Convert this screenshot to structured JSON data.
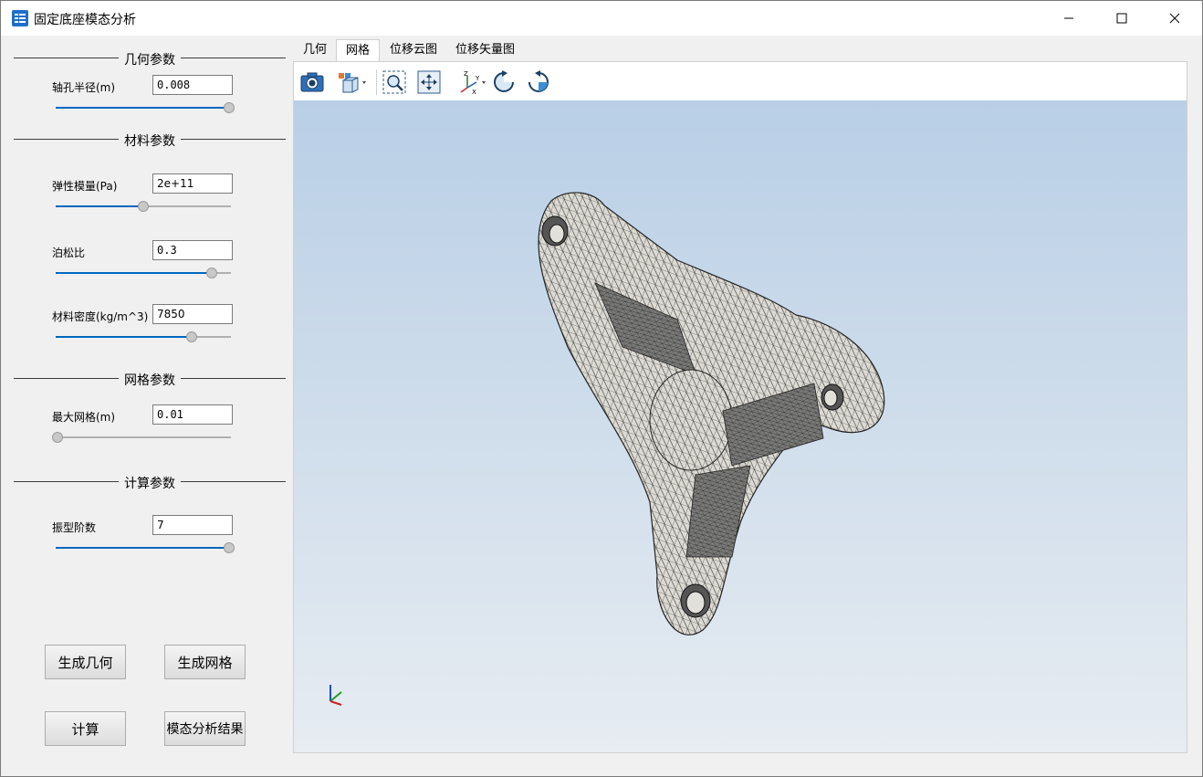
{
  "window": {
    "title": "固定底座模态分析",
    "icon": "app-table-icon"
  },
  "groups": {
    "geometry": {
      "title": "几何参数"
    },
    "material": {
      "title": "材料参数"
    },
    "mesh": {
      "title": "网格参数"
    },
    "compute": {
      "title": "计算参数"
    }
  },
  "params": {
    "shaft_radius": {
      "label": "轴孔半径(m)",
      "value": "0.008",
      "slider": 1.0
    },
    "elastic_modulus": {
      "label": "弹性模量(Pa)",
      "value": "2e+11",
      "slider": 0.5
    },
    "poisson_ratio": {
      "label": "泊松比",
      "value": "0.3",
      "slider": 0.9
    },
    "density": {
      "label": "材料密度(kg/m^3)",
      "value": "7850",
      "slider": 0.78
    },
    "max_mesh": {
      "label": "最大网格(m)",
      "value": "0.01",
      "slider": 0.0
    },
    "mode_order": {
      "label": "振型阶数",
      "value": "7",
      "slider": 1.0
    }
  },
  "buttons": {
    "gen_geometry": "生成几何",
    "gen_mesh": "生成网格",
    "compute": "计算",
    "modal_results": "模态分析结果"
  },
  "tabs": [
    {
      "label": "几何",
      "active": false
    },
    {
      "label": "网格",
      "active": true
    },
    {
      "label": "位移云图",
      "active": false
    },
    {
      "label": "位移矢量图",
      "active": false
    }
  ],
  "toolbar": [
    "camera-icon",
    "view-cube-icon",
    "zoom-box-icon",
    "fit-all-icon",
    "axes-icon",
    "rotate-cw-icon",
    "rotate-ccw-icon"
  ],
  "colors": {
    "accent": "#0067c0",
    "viewport_top": "#b9cfe6",
    "viewport_bottom": "#e7ecf2"
  }
}
